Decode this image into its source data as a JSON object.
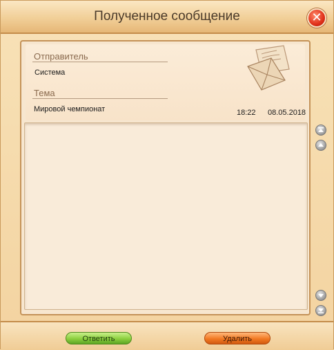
{
  "window": {
    "title": "Полученное сообщение"
  },
  "message": {
    "sender_label": "Отправитель",
    "sender": "Система",
    "subject_label": "Тема",
    "subject": "Мировой чемпионат",
    "time": "18:22",
    "date": "08.05.2018",
    "body": ""
  },
  "buttons": {
    "reply": "Ответить",
    "delete": "Удалить"
  },
  "colors": {
    "reply": "#8ccf3f",
    "delete": "#f27a23",
    "close": "#e0301a"
  },
  "icons": [
    "close-icon",
    "envelope-icon",
    "scroll-top-icon",
    "scroll-up-icon",
    "scroll-down-icon",
    "scroll-bottom-icon"
  ]
}
